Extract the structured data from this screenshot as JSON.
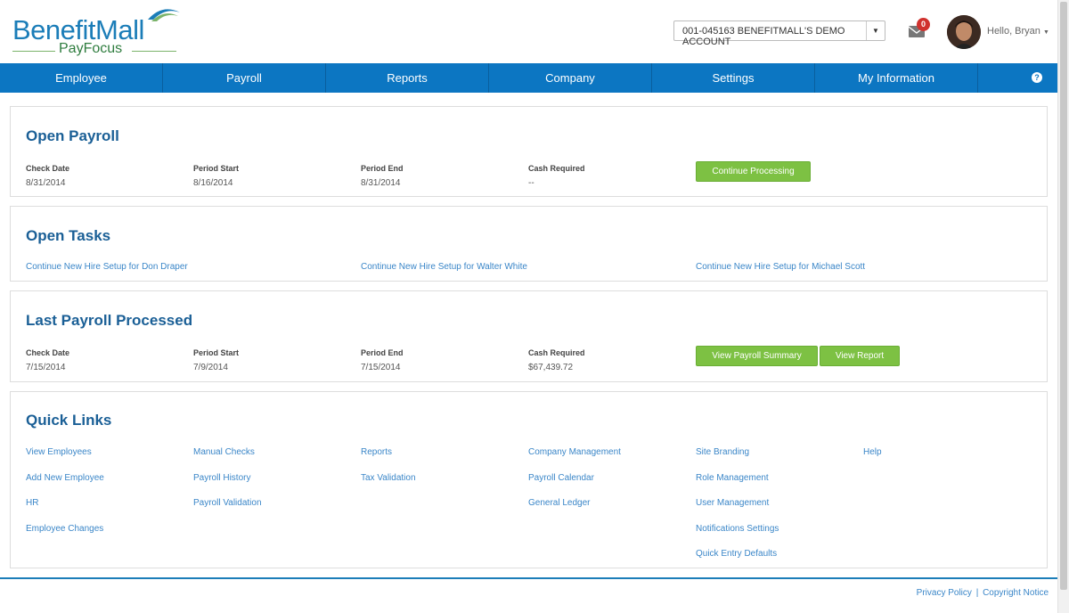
{
  "header": {
    "logo_brand": "BenefitMall",
    "logo_sub": "PayFocus",
    "account": "001-045163 BENEFITMALL'S DEMO ACCOUNT",
    "mail_count": "0",
    "greeting": "Hello, Bryan"
  },
  "nav": {
    "items": [
      "Employee",
      "Payroll",
      "Reports",
      "Company",
      "Settings",
      "My Information"
    ],
    "help": "?"
  },
  "open_payroll": {
    "title": "Open Payroll",
    "check_date_label": "Check Date",
    "check_date": "8/31/2014",
    "period_start_label": "Period Start",
    "period_start": "8/16/2014",
    "period_end_label": "Period End",
    "period_end": "8/31/2014",
    "cash_required_label": "Cash Required",
    "cash_required": "--",
    "continue_button": "Continue Processing"
  },
  "open_tasks": {
    "title": "Open Tasks",
    "tasks": [
      "Continue New Hire Setup for Don Draper",
      "Continue New Hire Setup for Walter White",
      "Continue New Hire Setup for Michael Scott"
    ]
  },
  "last_payroll": {
    "title": "Last Payroll Processed",
    "check_date_label": "Check Date",
    "check_date": "7/15/2014",
    "period_start_label": "Period Start",
    "period_start": "7/9/2014",
    "period_end_label": "Period End",
    "period_end": "7/15/2014",
    "cash_required_label": "Cash Required",
    "cash_required": "$67,439.72",
    "summary_button": "View Payroll Summary",
    "report_button": "View Report"
  },
  "quick_links": {
    "title": "Quick Links",
    "col1": [
      "View Employees",
      "Add New Employee",
      "HR",
      "Employee Changes"
    ],
    "col2": [
      "Manual Checks",
      "Payroll History",
      "Payroll Validation"
    ],
    "col3": [
      "Reports",
      "Tax Validation"
    ],
    "col4": [
      "Company Management",
      "Payroll Calendar",
      "General Ledger"
    ],
    "col5": [
      "Site Branding",
      "Role Management",
      "User Management",
      "Notifications Settings",
      "Quick Entry Defaults"
    ],
    "col6": [
      "Help"
    ]
  },
  "footer": {
    "privacy": "Privacy Policy",
    "separator": "|",
    "copyright": "Copyright Notice"
  },
  "colors": {
    "nav_blue": "#0c76c2",
    "heading_blue": "#1a5f96",
    "link_blue": "#3a86c8",
    "button_green": "#7dc143",
    "badge_red": "#d0312d"
  }
}
